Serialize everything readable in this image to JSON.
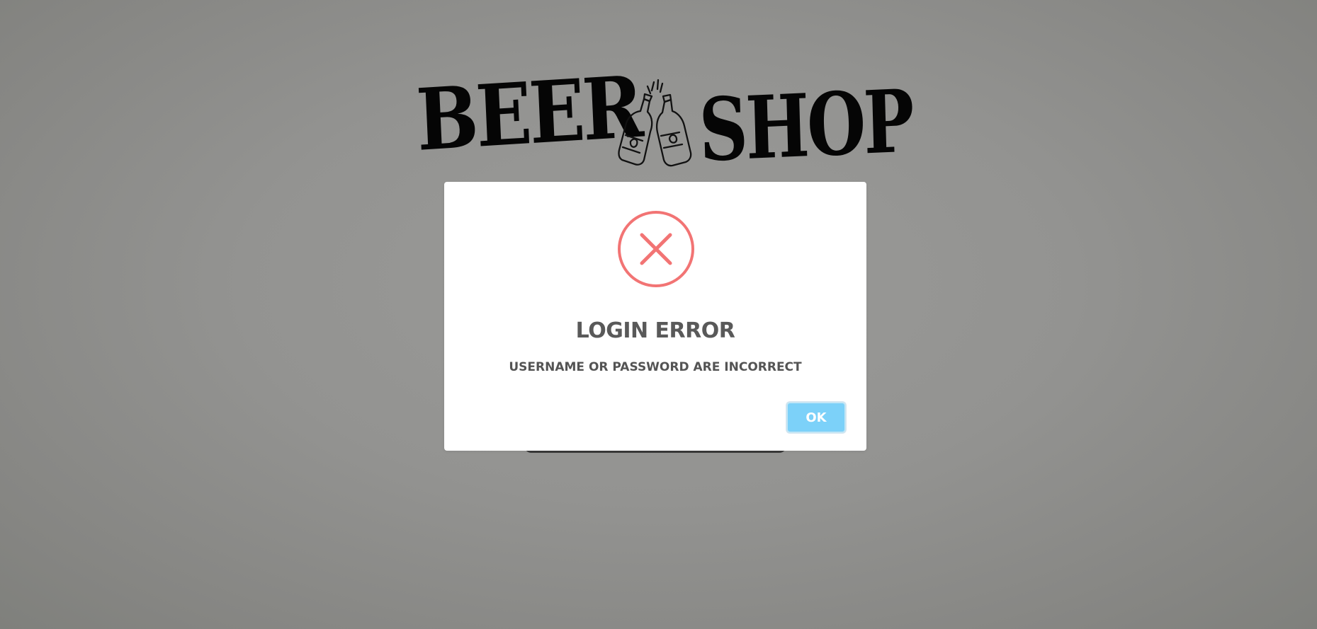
{
  "logo": {
    "word_left": "BEER",
    "word_right": "SHOP",
    "icon": "beer-bottles-icon"
  },
  "dialog": {
    "icon": "error-x-icon",
    "title": "LOGIN ERROR",
    "message": "USERNAME OR PASSWORD ARE INCORRECT",
    "ok_label": "OK"
  },
  "colors": {
    "overlay": "#8c8c8a",
    "error": "#f27474",
    "button": "#7cd1f9",
    "title_text": "#595959"
  }
}
